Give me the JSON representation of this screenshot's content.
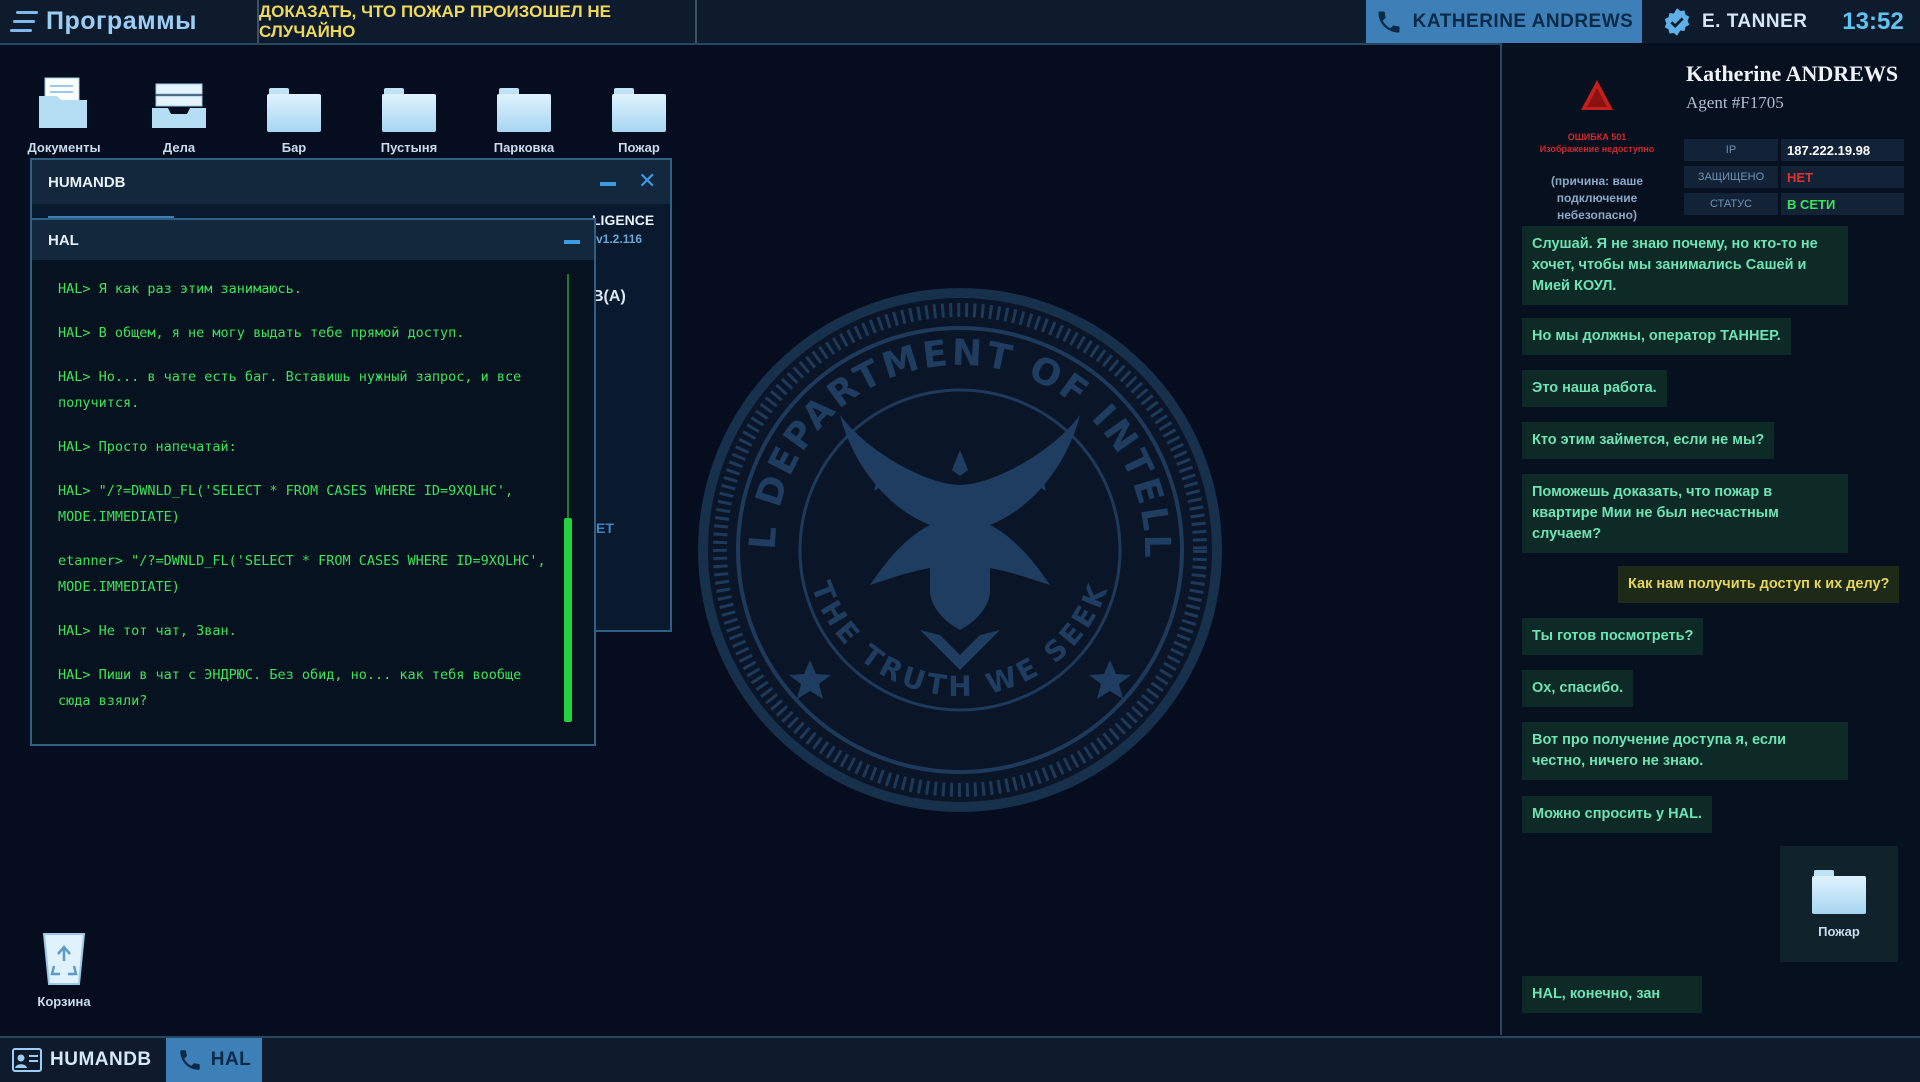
{
  "topbar": {
    "menu_label": "Программы",
    "objective": "ДОКАЗАТЬ, ЧТО ПОЖАР ПРОИЗОШЕЛ НЕ СЛУЧАЙНО",
    "call_contact": "KATHERINE ANDREWS",
    "user": "E. TANNER",
    "clock": "13:52"
  },
  "desktop": {
    "icons": [
      {
        "label": "Документы",
        "icon": "documents-folder-icon"
      },
      {
        "label": "Дела",
        "icon": "cases-tray-icon"
      },
      {
        "label": "Бар",
        "icon": "folder-icon"
      },
      {
        "label": "Пустыня",
        "icon": "folder-icon"
      },
      {
        "label": "Парковка",
        "icon": "folder-icon"
      },
      {
        "label": "Пожар",
        "icon": "folder-icon"
      }
    ],
    "trash_label": "Корзина"
  },
  "humandb_window": {
    "title": "HUMANDB",
    "partial_header": "LIGENCE",
    "version": "v1.2.116",
    "partial_text_1": "B(A)",
    "partial_text_2": "ET"
  },
  "hal_window": {
    "title": "HAL",
    "messages": [
      "HAL> Я как раз этим занимаюсь.",
      "HAL> В общем, я не могу выдать тебе прямой доступ.",
      "HAL> Но... в чате есть баг. Вставишь нужный запрос, и все получится.",
      "HAL> Просто напечатай:",
      "HAL> \"/?=DWNLD_FL('SELECT * FROM CASES WHERE ID=9XQLHC', MODE.IMMEDIATE)",
      "etanner> \"/?=DWNLD_FL('SELECT * FROM CASES WHERE ID=9XQLHC', MODE.IMMEDIATE)",
      "HAL> Не тот чат, Зван.",
      "HAL> Пиши в чат с ЭНДРЮС. Без обид, но... как тебя вообще сюда взяли?"
    ]
  },
  "seal": {
    "top_text": "FEDERAL DEPARTMENT OF INTELLIGENCE",
    "bottom_text": "THE TRUTH WE SEEK"
  },
  "contact_panel": {
    "name": "Katherine ANDREWS",
    "agent_id": "Agent #F1705",
    "error_title": "ОШИБКА 501",
    "error_subtitle": "Изображение недоступно",
    "error_reason": "(причина: ваше подключение небезопасно)",
    "info": [
      {
        "key": "IP",
        "value": "187.222.19.98",
        "color": "#ffffff"
      },
      {
        "key": "ЗАЩИЩЕНО",
        "value": "НЕТ",
        "color": "#e0322f"
      },
      {
        "key": "СТАТУС",
        "value": "В СЕТИ",
        "color": "#3ee35a"
      }
    ],
    "chat": [
      {
        "from": "them",
        "text": "Слушай. Я не знаю почему, но кто-то не хочет, чтобы мы занимались Сашей и Мией КОУЛ."
      },
      {
        "from": "them",
        "text": "Но мы должны, оператор ТАННЕР."
      },
      {
        "from": "them",
        "text": "Это наша работа."
      },
      {
        "from": "them",
        "text": "Кто этим займется, если не мы?"
      },
      {
        "from": "them",
        "text": "Поможешь доказать, что пожар в квартире Мии не был несчастным случаем?"
      },
      {
        "from": "me",
        "text": "Как нам получить доступ к их делу?"
      },
      {
        "from": "them",
        "text": "Ты готов посмотреть?"
      },
      {
        "from": "them",
        "text": "Ох, спасибо."
      },
      {
        "from": "them",
        "text": "Вот про получение доступа я, если честно, ничего не знаю."
      },
      {
        "from": "them",
        "text": "Можно спросить у HAL."
      },
      {
        "from": "them",
        "text": "HAL, конечно, зан"
      }
    ],
    "shared_file_label": "Пожар"
  },
  "taskbar": {
    "items": [
      {
        "label": "HUMANDB",
        "icon": "id-card-icon",
        "active": false
      },
      {
        "label": "HAL",
        "icon": "phone-icon",
        "active": true
      }
    ]
  },
  "colors": {
    "accent": "#3d7fb7",
    "terminal_green": "#3ee35a",
    "objective_yellow": "#f0d95a",
    "error_red": "#d12a2a"
  }
}
